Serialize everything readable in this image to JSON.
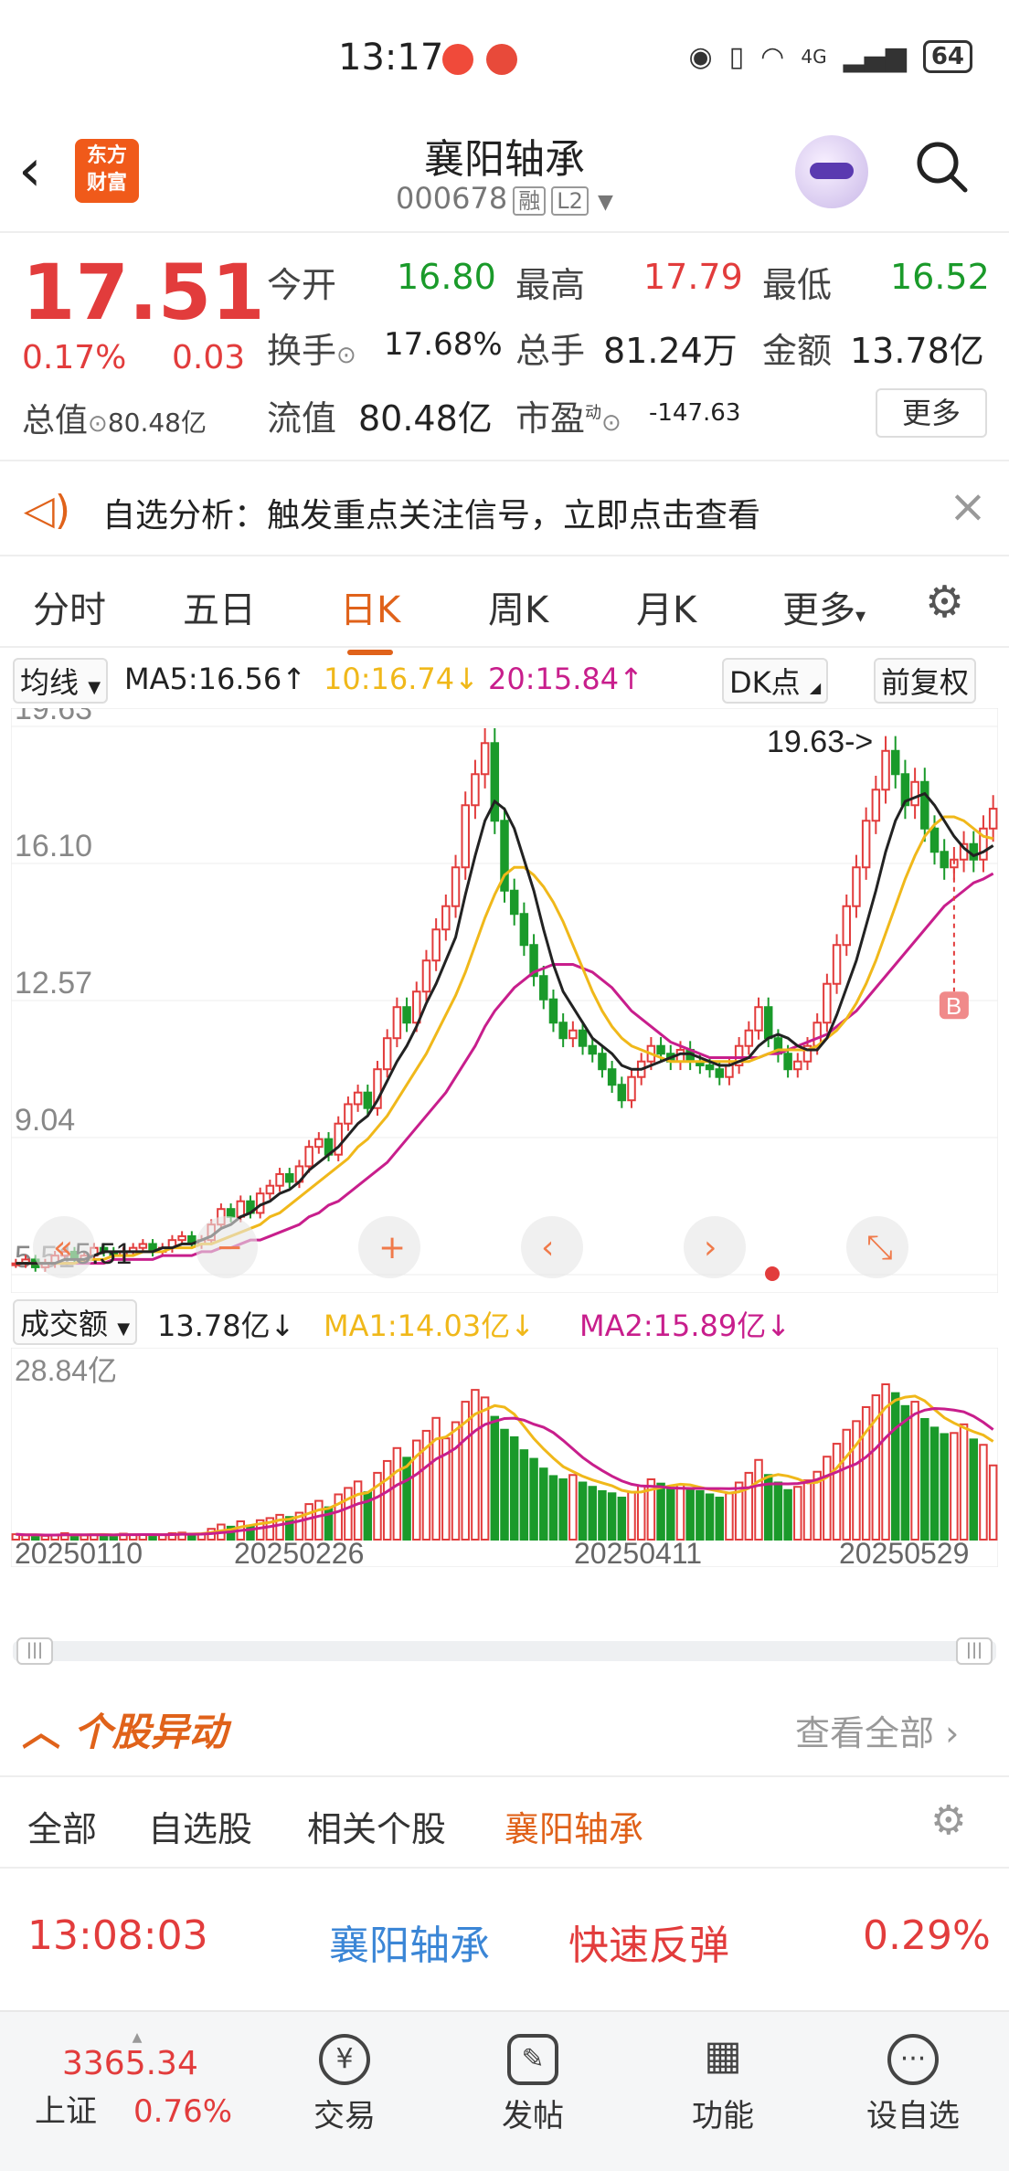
{
  "status": {
    "time": "13:17",
    "battery": "64",
    "network": "4G"
  },
  "header": {
    "title": "襄阳轴承",
    "code": "000678",
    "tag1": "融",
    "tag2": "L2",
    "logo": "东方\n财富"
  },
  "quote": {
    "price": "17.51",
    "pct": "0.17%",
    "change": "0.03",
    "open_label": "今开",
    "open": "16.80",
    "high_label": "最高",
    "high": "17.79",
    "low_label": "最低",
    "low": "16.52",
    "turnover_label": "换手",
    "turnover": "17.68%",
    "volume_label": "总手",
    "volume": "81.24万",
    "amount_label": "金额",
    "amount": "13.78亿",
    "mktcap_label": "总值",
    "mktcap": "80.48亿",
    "float_label": "流值",
    "float": "80.48亿",
    "pe_label": "市盈",
    "pe_sup": "动",
    "pe": "-147.63",
    "more": "更多"
  },
  "alert": {
    "text": "自选分析：触发重点关注信号，立即点击查看"
  },
  "period_tabs": [
    "分时",
    "五日",
    "日K",
    "周K",
    "月K",
    "更多"
  ],
  "ma": {
    "selector": "均线",
    "ma5": "MA5:16.56↑",
    "ma10": "10:16.74↓",
    "ma20": "20:15.84↑",
    "dk": "DK点",
    "adjust": "前复权"
  },
  "volume": {
    "selector": "成交额",
    "current": "13.78亿↓",
    "ma1": "MA1:14.03亿↓",
    "ma2": "MA2:15.89亿↓",
    "max_label": "28.84亿"
  },
  "chart_data": {
    "type": "candlestick",
    "y_ticks": [
      "19.63",
      "16.10",
      "12.57",
      "9.04",
      "5.51"
    ],
    "ylim": [
      5.51,
      19.63
    ],
    "high_annotation": "19.63->",
    "low_annotation": "5.51",
    "signal_marker": "B",
    "dates": [
      "20250110",
      "20250226",
      "20250411",
      "20250529"
    ],
    "close": [
      5.8,
      5.9,
      5.7,
      5.8,
      6.0,
      6.1,
      5.9,
      6.0,
      6.2,
      6.1,
      6.0,
      6.1,
      6.2,
      6.3,
      6.1,
      6.2,
      6.4,
      6.5,
      6.3,
      6.4,
      6.8,
      7.2,
      7.0,
      7.4,
      7.1,
      7.6,
      7.8,
      8.1,
      7.9,
      8.3,
      8.8,
      9.0,
      8.6,
      9.4,
      9.9,
      10.2,
      9.8,
      10.8,
      11.6,
      12.4,
      12.0,
      12.8,
      13.6,
      14.4,
      15.0,
      16.0,
      17.6,
      18.4,
      19.2,
      17.2,
      15.4,
      14.8,
      14.0,
      13.2,
      12.6,
      12.0,
      11.6,
      11.8,
      11.4,
      11.2,
      10.8,
      10.4,
      10.0,
      10.6,
      11.0,
      11.4,
      11.2,
      11.0,
      11.3,
      11.0,
      10.9,
      10.8,
      10.6,
      10.9,
      11.4,
      11.8,
      12.4,
      11.6,
      11.2,
      10.8,
      11.0,
      11.4,
      12.0,
      13.0,
      14.0,
      15.0,
      16.0,
      17.2,
      18.0,
      19.0,
      18.4,
      17.6,
      18.2,
      17.0,
      16.4,
      16.0,
      16.2,
      16.6,
      16.2,
      17.0,
      17.51
    ],
    "ma5": [
      5.8,
      5.8,
      5.8,
      5.8,
      5.8,
      5.9,
      5.9,
      5.9,
      6.0,
      6.1,
      6.1,
      6.1,
      6.1,
      6.1,
      6.1,
      6.2,
      6.2,
      6.3,
      6.3,
      6.4,
      6.5,
      6.7,
      6.8,
      7.0,
      7.1,
      7.3,
      7.4,
      7.6,
      7.7,
      7.9,
      8.2,
      8.4,
      8.6,
      8.8,
      9.1,
      9.4,
      9.6,
      10.0,
      10.5,
      11.0,
      11.4,
      11.9,
      12.5,
      13.0,
      13.6,
      14.2,
      15.3,
      16.3,
      17.2,
      17.7,
      17.5,
      17.0,
      16.2,
      15.4,
      14.4,
      13.5,
      12.8,
      12.4,
      12.0,
      11.6,
      11.4,
      11.2,
      10.9,
      10.8,
      10.8,
      10.9,
      11.0,
      11.1,
      11.2,
      11.2,
      11.1,
      11.0,
      10.9,
      10.9,
      11.0,
      11.1,
      11.4,
      11.6,
      11.7,
      11.6,
      11.4,
      11.3,
      11.3,
      11.6,
      12.2,
      12.9,
      13.6,
      14.5,
      15.4,
      16.4,
      17.2,
      17.7,
      17.8,
      17.9,
      17.6,
      17.2,
      16.8,
      16.5,
      16.3,
      16.4,
      16.56
    ],
    "ma10": [
      5.8,
      5.8,
      5.8,
      5.8,
      5.8,
      5.8,
      5.8,
      5.9,
      5.9,
      5.9,
      6.0,
      6.0,
      6.0,
      6.1,
      6.1,
      6.1,
      6.2,
      6.2,
      6.2,
      6.3,
      6.3,
      6.4,
      6.5,
      6.6,
      6.7,
      6.8,
      7.0,
      7.1,
      7.3,
      7.5,
      7.7,
      7.9,
      8.1,
      8.3,
      8.5,
      8.8,
      9.0,
      9.3,
      9.6,
      10.0,
      10.4,
      10.8,
      11.2,
      11.7,
      12.2,
      12.7,
      13.3,
      14.0,
      14.7,
      15.3,
      15.8,
      16.0,
      16.0,
      15.8,
      15.5,
      15.1,
      14.6,
      14.0,
      13.4,
      12.8,
      12.3,
      11.9,
      11.6,
      11.4,
      11.3,
      11.2,
      11.1,
      11.0,
      11.0,
      11.0,
      11.0,
      11.0,
      11.0,
      11.0,
      11.0,
      11.0,
      11.1,
      11.2,
      11.3,
      11.3,
      11.3,
      11.3,
      11.4,
      11.6,
      11.8,
      12.1,
      12.5,
      13.0,
      13.6,
      14.3,
      15.0,
      15.7,
      16.3,
      16.8,
      17.1,
      17.3,
      17.3,
      17.2,
      17.0,
      16.8,
      16.74
    ],
    "ma20": [
      5.8,
      5.8,
      5.8,
      5.8,
      5.8,
      5.8,
      5.8,
      5.8,
      5.8,
      5.8,
      5.9,
      5.9,
      5.9,
      5.9,
      5.9,
      6.0,
      6.0,
      6.0,
      6.0,
      6.1,
      6.1,
      6.2,
      6.2,
      6.3,
      6.4,
      6.4,
      6.5,
      6.6,
      6.7,
      6.8,
      7.0,
      7.1,
      7.3,
      7.4,
      7.6,
      7.8,
      8.0,
      8.2,
      8.4,
      8.7,
      9.0,
      9.3,
      9.6,
      9.9,
      10.2,
      10.6,
      11.0,
      11.4,
      11.9,
      12.3,
      12.6,
      12.9,
      13.1,
      13.3,
      13.4,
      13.5,
      13.5,
      13.5,
      13.4,
      13.3,
      13.1,
      12.9,
      12.6,
      12.3,
      12.1,
      11.9,
      11.7,
      11.5,
      11.4,
      11.3,
      11.2,
      11.1,
      11.1,
      11.1,
      11.1,
      11.1,
      11.1,
      11.2,
      11.2,
      11.3,
      11.4,
      11.5,
      11.6,
      11.7,
      11.9,
      12.1,
      12.3,
      12.6,
      12.9,
      13.2,
      13.5,
      13.8,
      14.1,
      14.4,
      14.7,
      15.0,
      15.2,
      15.4,
      15.6,
      15.7,
      15.84
    ],
    "volume_yi": [
      1.0,
      0.8,
      0.9,
      0.7,
      0.8,
      1.2,
      0.9,
      0.8,
      1.0,
      0.9,
      0.8,
      1.1,
      0.9,
      1.0,
      0.8,
      0.9,
      1.2,
      1.3,
      1.0,
      1.1,
      2.0,
      2.8,
      2.4,
      3.4,
      2.6,
      3.6,
      4.0,
      4.6,
      4.2,
      5.0,
      6.6,
      7.2,
      6.0,
      8.4,
      9.6,
      10.8,
      8.8,
      12.4,
      14.6,
      17.0,
      15.2,
      18.4,
      20.2,
      22.6,
      18.8,
      21.8,
      25.6,
      27.8,
      26.4,
      22.8,
      20.4,
      19.0,
      16.6,
      15.0,
      13.2,
      11.8,
      11.2,
      12.0,
      10.6,
      9.8,
      9.0,
      8.6,
      7.8,
      8.8,
      10.0,
      11.2,
      10.4,
      9.6,
      10.2,
      9.4,
      9.0,
      8.4,
      7.8,
      8.6,
      10.6,
      12.4,
      14.8,
      12.0,
      10.6,
      9.2,
      9.8,
      11.0,
      12.6,
      15.4,
      17.8,
      20.4,
      22.0,
      24.6,
      26.8,
      28.84,
      27.2,
      24.8,
      25.6,
      22.4,
      20.8,
      19.6,
      19.8,
      21.4,
      18.6,
      17.6,
      13.78
    ]
  },
  "movement": {
    "title": "个股异动",
    "view_all": "查看全部",
    "tabs": [
      "全部",
      "自选股",
      "相关个股",
      "襄阳轴承"
    ],
    "row": {
      "time": "13:08:03",
      "name": "襄阳轴承",
      "event": "快速反弹",
      "pct": "0.29%"
    }
  },
  "bottom_nav": {
    "index_value": "3365.34",
    "index_name": "上证",
    "index_pct": "0.76%",
    "items": [
      "交易",
      "发帖",
      "功能",
      "设自选"
    ]
  },
  "colors": {
    "up": "#e23c3c",
    "down": "#1a9a2a",
    "accent": "#e0621a",
    "ma5": "#222222",
    "ma10": "#f0b81a",
    "ma20": "#c81e8c"
  }
}
